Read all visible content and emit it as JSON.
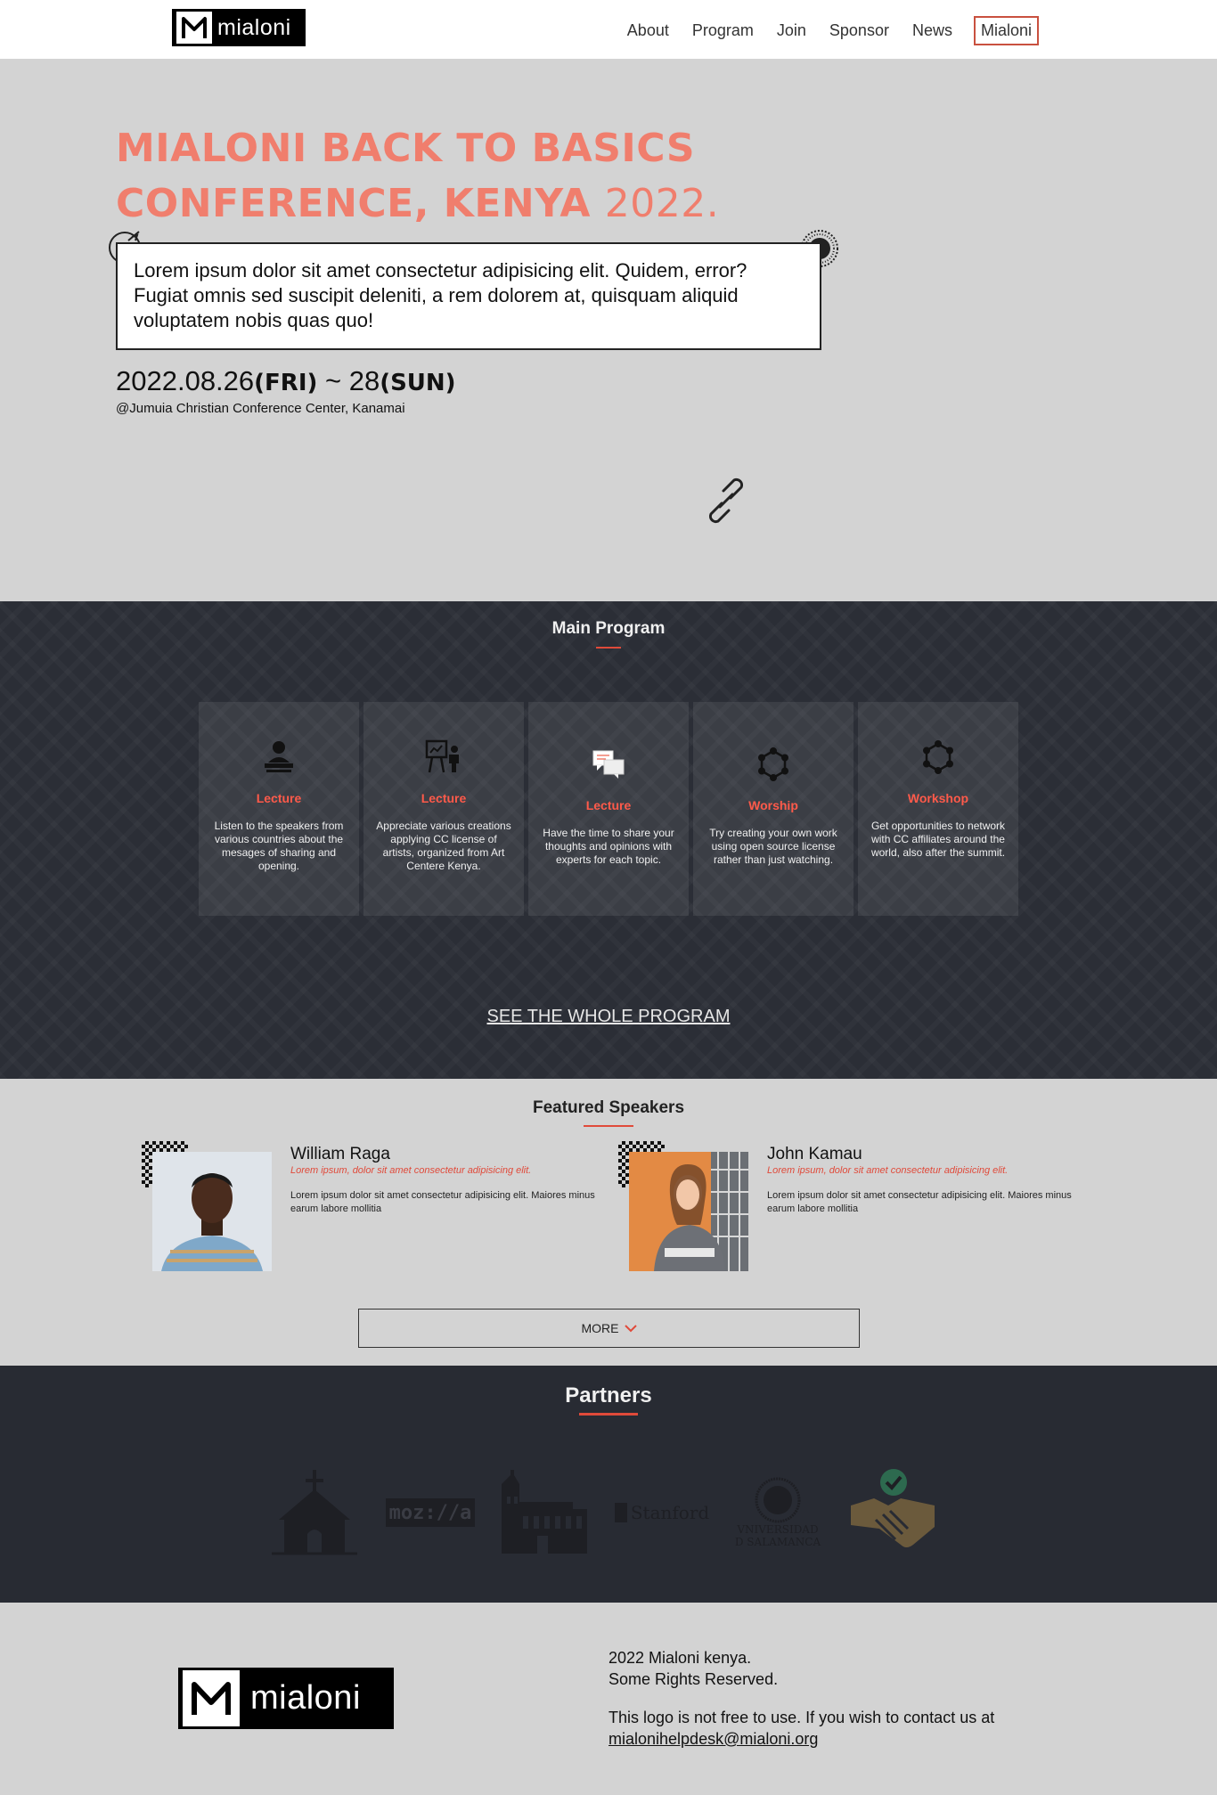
{
  "nav": {
    "logo_text": "mialoni",
    "links": [
      "About",
      "Program",
      "Join",
      "Sponsor",
      "News"
    ],
    "highlight_link": "Mialoni"
  },
  "hero": {
    "title_line1": "MIALONI BACK TO BASICS",
    "title_line2": "CONFERENCE, KENYA",
    "title_year": "2022.",
    "description": "Lorem ipsum dolor sit amet consectetur adipisicing elit. Quidem, error? Fugiat omnis sed suscipit deleniti, a rem dolorem at, quisquam aliquid voluptatem nobis quas quo!",
    "date_start": "2022.08.26",
    "day_start": "(FRI)",
    "date_sep": " ~ 28",
    "day_end": "(SUN)",
    "venue": "@Jumuia Christian Conference Center, Kanamai"
  },
  "program": {
    "title": "Main Program",
    "cards": [
      {
        "icon": "lecture-podium-icon",
        "title": "Lecture",
        "desc": "Listen to the speakers from various countries about the mesages of sharing and opening."
      },
      {
        "icon": "presentation-icon",
        "title": "Lecture",
        "desc": "Appreciate various creations applying CC license of artists, organized from Art Centere Kenya."
      },
      {
        "icon": "chat-bubbles-icon",
        "title": "Lecture",
        "desc": "Have the time to share your thoughts and opinions with experts for each topic."
      },
      {
        "icon": "network-hexagon-icon",
        "title": "Worship",
        "desc": "Try creating your own work using open source license rather than just watching."
      },
      {
        "icon": "network-hexagon-icon",
        "title": "Workshop",
        "desc": "Get opportunities to network with CC affiliates around the world, also after the summit."
      }
    ],
    "see_all": "SEE THE WHOLE PROGRAM"
  },
  "speakers": {
    "title": "Featured Speakers",
    "items": [
      {
        "name": "William Raga",
        "tagline": "Lorem ipsum, dolor sit amet consectetur adipisicing elit.",
        "bio": "Lorem ipsum dolor sit amet consectetur adipisicing elit. Maiores minus earum labore mollitia"
      },
      {
        "name": "John Kamau",
        "tagline": "Lorem ipsum, dolor sit amet consectetur adipisicing elit.",
        "bio": "Lorem ipsum dolor sit amet consectetur adipisicing elit. Maiores minus earum labore mollitia"
      }
    ],
    "more_label": "MORE"
  },
  "partners": {
    "title": "Partners",
    "logos": [
      "church-logo",
      "mozilla-logo",
      "cathedral-logo",
      "stanford-logo",
      "salamanca-logo",
      "handshake-logo"
    ],
    "mozilla_text": "moz://a",
    "stanford_text": "Stanford",
    "salamanca_line1": "VNIVERSIDAD",
    "salamanca_line2": "D SALAMANCA"
  },
  "footer": {
    "logo_text": "mialoni",
    "line1": "2022 Mialoni kenya.",
    "line2": "Some Rights Reserved.",
    "contact_text": "This logo is not free to use. If you wish to contact us at",
    "email": "mialonihelpdesk@mialoni.org"
  },
  "colors": {
    "accent": "#e04a3a",
    "hero_title": "#f07e6d",
    "dark_section": "#2b2e36"
  }
}
